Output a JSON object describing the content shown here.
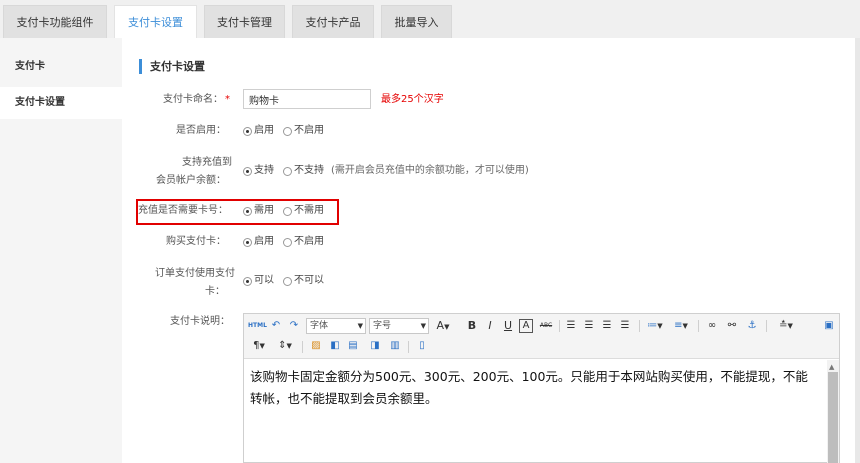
{
  "tabs": [
    {
      "label": "支付卡功能组件"
    },
    {
      "label": "支付卡设置"
    },
    {
      "label": "支付卡管理"
    },
    {
      "label": "支付卡产品"
    },
    {
      "label": "批量导入"
    }
  ],
  "sidebar": {
    "items": [
      {
        "label": "支付卡"
      },
      {
        "label": "支付卡设置"
      }
    ]
  },
  "section": {
    "title": "支付卡设置"
  },
  "form": {
    "name": {
      "label": "支付卡命名：",
      "required_mark": "*",
      "value": "购物卡",
      "hint": "最多25个汉字"
    },
    "enable": {
      "label": "是否启用：",
      "options": [
        "启用",
        "不启用"
      ],
      "selected": "启用"
    },
    "recharge": {
      "label_line1": "支持充值到",
      "label_line2": "会员帐户余额：",
      "options": [
        "支持",
        "不支持"
      ],
      "selected": "支持",
      "hint": "(需开启会员充值中的余额功能，才可以使用)"
    },
    "card_number": {
      "label": "充值是否需要卡号：",
      "options": [
        "需用",
        "不需用"
      ],
      "selected": "需用"
    },
    "purchase": {
      "label": "购买支付卡：",
      "options": [
        "启用",
        "不启用"
      ],
      "selected": "启用"
    },
    "order_pay": {
      "label_line1": "订单支付使用支付",
      "label_line2": "卡：",
      "options": [
        "可以",
        "不可以"
      ],
      "selected": "可以"
    },
    "description": {
      "label": "支付卡说明：",
      "content": "该购物卡固定金额分为500元、300元、200元、100元。只能用于本网站购买使用，不能提现，不能转帐，也不能提取到会员余额里。"
    }
  },
  "editor": {
    "toolbar": {
      "html_label": "HTML",
      "font_family": "字体",
      "font_size": "字号",
      "bold": "B",
      "italic": "I",
      "underline": "U",
      "font_letter": "A",
      "strike": "ABC"
    }
  }
}
